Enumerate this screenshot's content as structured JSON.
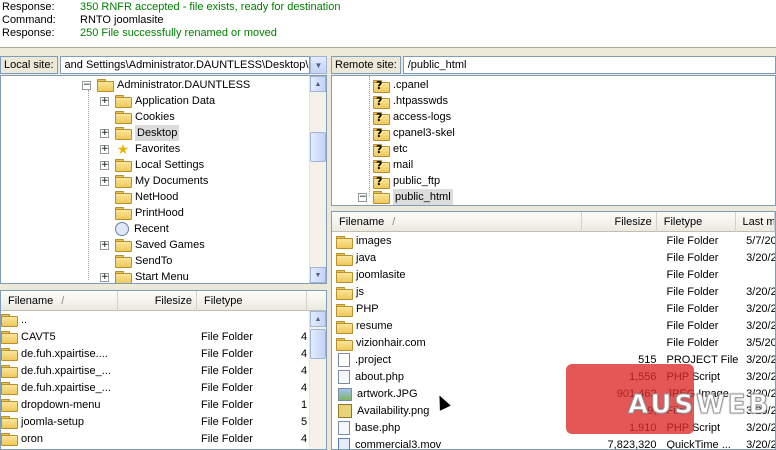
{
  "log": [
    {
      "label": "Response:",
      "message": "350 RNFR accepted - file exists, ready for destination",
      "color": "#008000"
    },
    {
      "label": "Command:",
      "message": "RNTO joomlasite",
      "color": "#000000"
    },
    {
      "label": "Response:",
      "message": "250 File successfully renamed or moved",
      "color": "#008000"
    }
  ],
  "local_site": {
    "label": "Local site:",
    "path": "and Settings\\Administrator.DAUNTLESS\\Desktop\\"
  },
  "remote_site": {
    "label": "Remote site:",
    "path": "/public_html"
  },
  "local_tree": [
    {
      "label": "Administrator.DAUNTLESS",
      "expander": "−",
      "icon": "folder-icon"
    },
    {
      "label": "Application Data",
      "expander": "+",
      "icon": "folder-icon"
    },
    {
      "label": "Cookies",
      "expander": "",
      "icon": "folder-icon"
    },
    {
      "label": "Desktop",
      "expander": "+",
      "icon": "folder-icon",
      "selected": true
    },
    {
      "label": "Favorites",
      "expander": "+",
      "icon": "star-icon"
    },
    {
      "label": "Local Settings",
      "expander": "+",
      "icon": "folder-icon"
    },
    {
      "label": "My Documents",
      "expander": "+",
      "icon": "folder-icon"
    },
    {
      "label": "NetHood",
      "expander": "",
      "icon": "folder-icon"
    },
    {
      "label": "PrintHood",
      "expander": "",
      "icon": "folder-icon"
    },
    {
      "label": "Recent",
      "expander": "",
      "icon": "recent-icon"
    },
    {
      "label": "Saved Games",
      "expander": "+",
      "icon": "folder-icon"
    },
    {
      "label": "SendTo",
      "expander": "",
      "icon": "folder-icon"
    },
    {
      "label": "Start Menu",
      "expander": "+",
      "icon": "folder-icon"
    }
  ],
  "remote_tree": [
    {
      "label": ".cpanel",
      "icon": "question-folder-icon"
    },
    {
      "label": ".htpasswds",
      "icon": "question-folder-icon"
    },
    {
      "label": "access-logs",
      "icon": "question-folder-icon"
    },
    {
      "label": "cpanel3-skel",
      "icon": "question-folder-icon"
    },
    {
      "label": "etc",
      "icon": "question-folder-icon"
    },
    {
      "label": "mail",
      "icon": "question-folder-icon"
    },
    {
      "label": "public_ftp",
      "icon": "question-folder-icon"
    },
    {
      "label": "public_html",
      "icon": "folder-icon",
      "expander": "−",
      "selected": true
    }
  ],
  "local_list": {
    "headers": {
      "filename": "Filename",
      "sort": "/",
      "filesize": "Filesize",
      "filetype": "Filetype"
    },
    "rows": [
      {
        "name": "..",
        "size": "",
        "type": "",
        "extra": ""
      },
      {
        "name": "CAVT5",
        "size": "",
        "type": "File Folder",
        "extra": "4"
      },
      {
        "name": "de.fuh.xpairtise....",
        "size": "",
        "type": "File Folder",
        "extra": "4"
      },
      {
        "name": "de.fuh.xpairtise_...",
        "size": "",
        "type": "File Folder",
        "extra": "4"
      },
      {
        "name": "de.fuh.xpairtise_...",
        "size": "",
        "type": "File Folder",
        "extra": "4"
      },
      {
        "name": "dropdown-menu",
        "size": "",
        "type": "File Folder",
        "extra": "1"
      },
      {
        "name": "joomla-setup",
        "size": "",
        "type": "File Folder",
        "extra": "5"
      },
      {
        "name": "oron",
        "size": "",
        "type": "File Folder",
        "extra": "4"
      }
    ]
  },
  "remote_list": {
    "headers": {
      "filename": "Filename",
      "sort": "/",
      "filesize": "Filesize",
      "filetype": "Filetype",
      "lastmod": "Last m"
    },
    "rows": [
      {
        "name": "images",
        "icon": "folder-icon",
        "size": "",
        "type": "File Folder",
        "date": "5/7/20"
      },
      {
        "name": "java",
        "icon": "folder-icon",
        "size": "",
        "type": "File Folder",
        "date": "3/20/2"
      },
      {
        "name": "joomlasite",
        "icon": "folder-icon",
        "size": "",
        "type": "File Folder",
        "date": ""
      },
      {
        "name": "js",
        "icon": "folder-icon",
        "size": "",
        "type": "File Folder",
        "date": "3/20/2"
      },
      {
        "name": "PHP",
        "icon": "folder-icon",
        "size": "",
        "type": "File Folder",
        "date": "3/20/2"
      },
      {
        "name": "resume",
        "icon": "folder-icon",
        "size": "",
        "type": "File Folder",
        "date": "3/20/2"
      },
      {
        "name": "vizionhair.com",
        "icon": "folder-icon",
        "size": "",
        "type": "File Folder",
        "date": "3/5/20"
      },
      {
        "name": ".project",
        "icon": "file-icon",
        "size": "515",
        "type": "PROJECT File",
        "date": "3/20/2"
      },
      {
        "name": "about.php",
        "icon": "php-file-icon",
        "size": "1,556",
        "type": "PHP Script",
        "date": "3/20/2"
      },
      {
        "name": "artwork.JPG",
        "icon": "image-file-icon",
        "size": "901,462",
        "type": "JPEG Image",
        "date": "3/20/2"
      },
      {
        "name": "Availability.png",
        "icon": "png-file-icon",
        "size": "9,",
        "type": "File",
        "date": "3/20/2"
      },
      {
        "name": "base.php",
        "icon": "php-file-icon",
        "size": "1,910",
        "type": "PHP Script",
        "date": "3/20/2"
      },
      {
        "name": "commercial3.mov",
        "icon": "movie-file-icon",
        "size": "7,823,320",
        "type": "QuickTime ...",
        "date": "3/20/2"
      }
    ]
  },
  "watermark": {
    "text": "AUSWEB",
    "color": "#dc2828"
  }
}
